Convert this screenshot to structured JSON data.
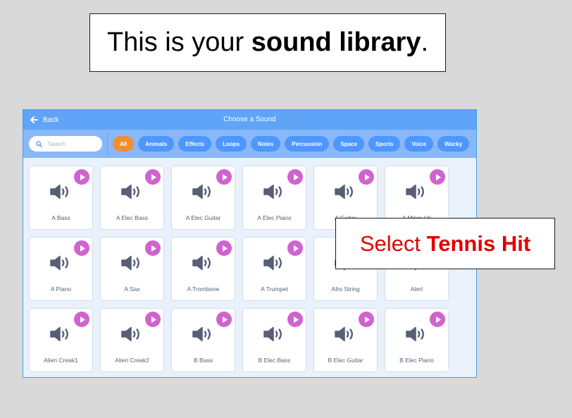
{
  "callout_top": {
    "prefix": "This is your ",
    "bold": "sound library",
    "suffix": "."
  },
  "callout_tip": {
    "prefix": "Select ",
    "bold": "Tennis Hit"
  },
  "modal": {
    "back_label": "Back",
    "title": "Choose a Sound",
    "search_placeholder": "Search",
    "tags": [
      "All",
      "Animals",
      "Effects",
      "Loops",
      "Notes",
      "Percussion",
      "Space",
      "Sports",
      "Voice",
      "Wacky"
    ],
    "active_tag": "All",
    "sounds": [
      "A Bass",
      "A Elec Bass",
      "A Elec Guitar",
      "A Elec Piano",
      "A Guitar",
      "A Minor Uk",
      "A Piano",
      "A Sax",
      "A Trombone",
      "A Trumpet",
      "Afro String",
      "Alert",
      "Alien Creak1",
      "Alien Creak2",
      "B Bass",
      "B Elec Bass",
      "B Elec Guitar",
      "B Elec Piano"
    ]
  },
  "colors": {
    "header": "#5fa4f7",
    "filter_bar": "#89b8f8",
    "tag": "#4d97ff",
    "tag_active": "#f38d31",
    "play_button": "#cf63cf",
    "speaker_icon": "#575e75",
    "tip_text": "#e00000"
  },
  "icons": {
    "back": "arrow-left-icon",
    "search": "search-icon",
    "play": "play-icon",
    "sound": "speaker-icon"
  }
}
